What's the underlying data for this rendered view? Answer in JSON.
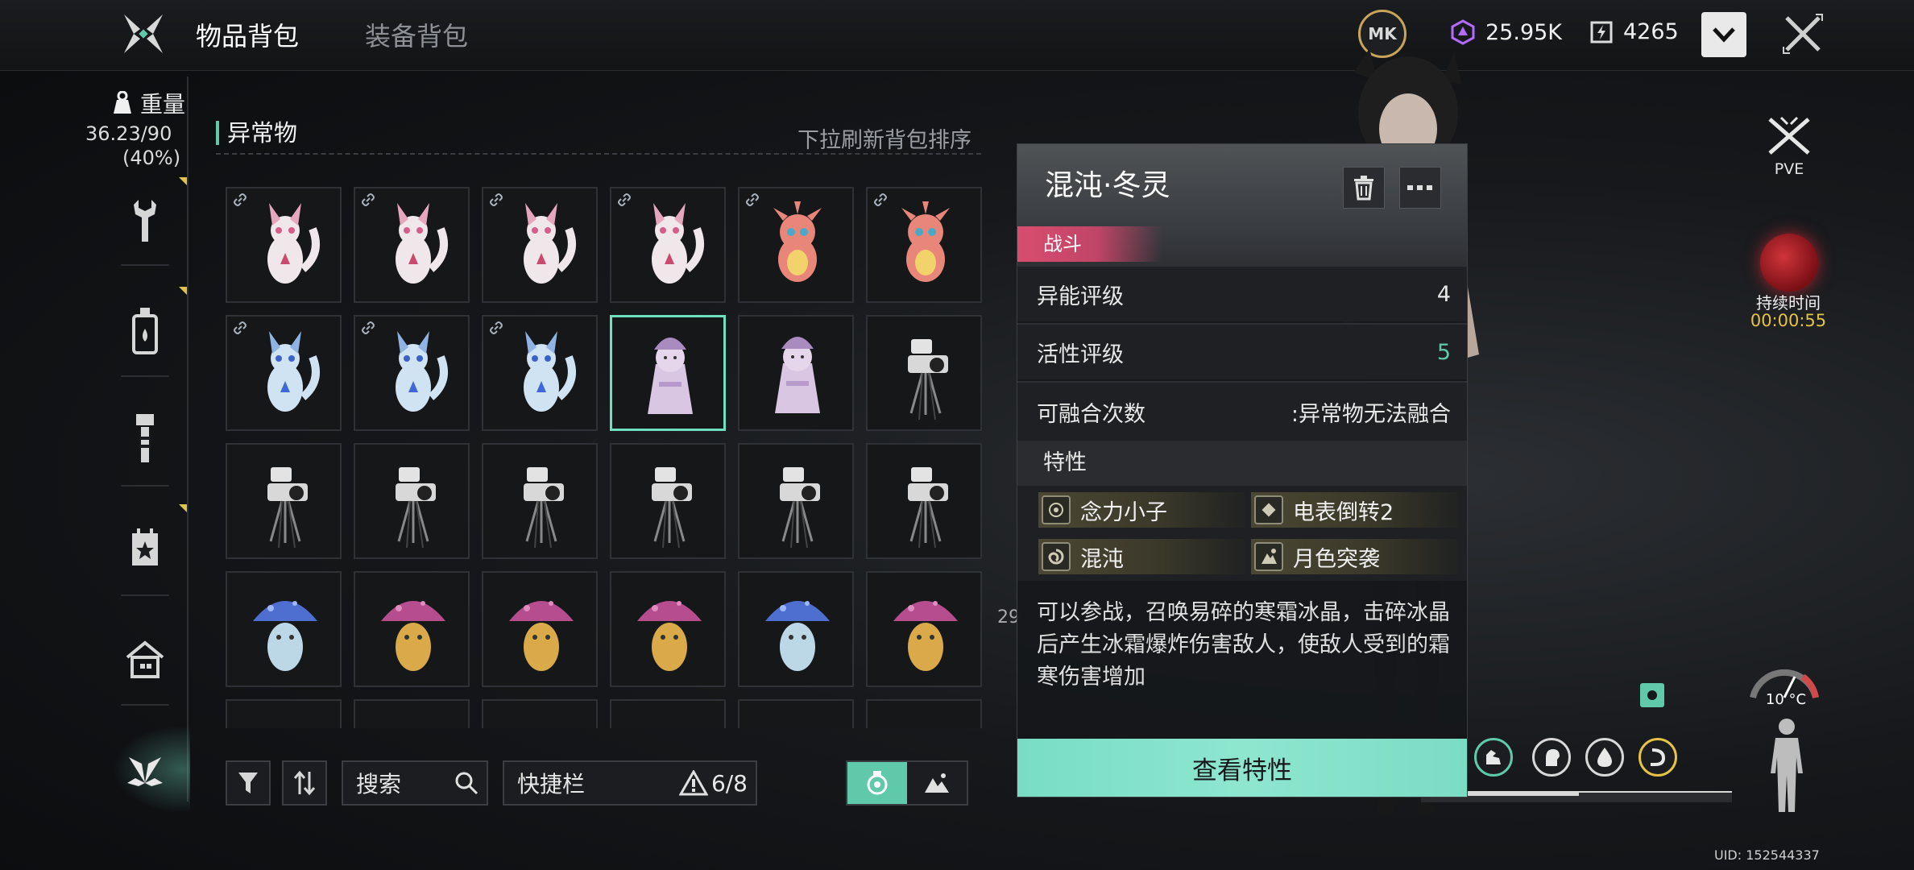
{
  "header": {
    "tabs": [
      {
        "label": "物品背包",
        "active": true
      },
      {
        "label": "装备背包",
        "active": false
      }
    ],
    "emblem_text": "MK",
    "currency_1": "25.95K",
    "currency_2": "4265"
  },
  "sidebar": {
    "weight_label": "重量",
    "weight_value": "36.23/90",
    "weight_percent": "(40%)",
    "items": [
      "wrench-icon",
      "bottle-icon",
      "tool-icon",
      "calendar-star-icon",
      "house-icon",
      "anomaly-icon"
    ]
  },
  "inventory": {
    "section_title": "异常物",
    "refresh_hint": "下拉刷新背包排序",
    "search_label": "搜索",
    "quickbar_label": "快捷栏",
    "quickbar_count": "6/8"
  },
  "detail": {
    "name": "混沌·冬灵",
    "type_tag": "战斗",
    "stats": [
      {
        "label": "异能评级",
        "value": "4"
      },
      {
        "label": "活性评级",
        "value": "5"
      },
      {
        "label": "可融合次数",
        "value": ":异常物无法融合"
      }
    ],
    "traits_title": "特性",
    "traits": [
      "念力小子",
      "电表倒转2",
      "混沌",
      "月色突袭"
    ],
    "description": "可以参战，召唤易碎的寒霜冰晶，击碎冰晶后产生冰霜爆炸伤害敌人，使敌人受到的霜寒伤害增加",
    "button_label": "查看特性"
  },
  "right": {
    "mode_label": "PVE",
    "duration_label": "持续时间",
    "duration_value": "00:00:55",
    "temperature": "10 °C",
    "uid": "UID: 152544337"
  },
  "colors": {
    "accent": "#5fc9a9",
    "tag": "#d94d6f",
    "highlight_value": "#5fc9a9",
    "timer": "#e5c345"
  }
}
